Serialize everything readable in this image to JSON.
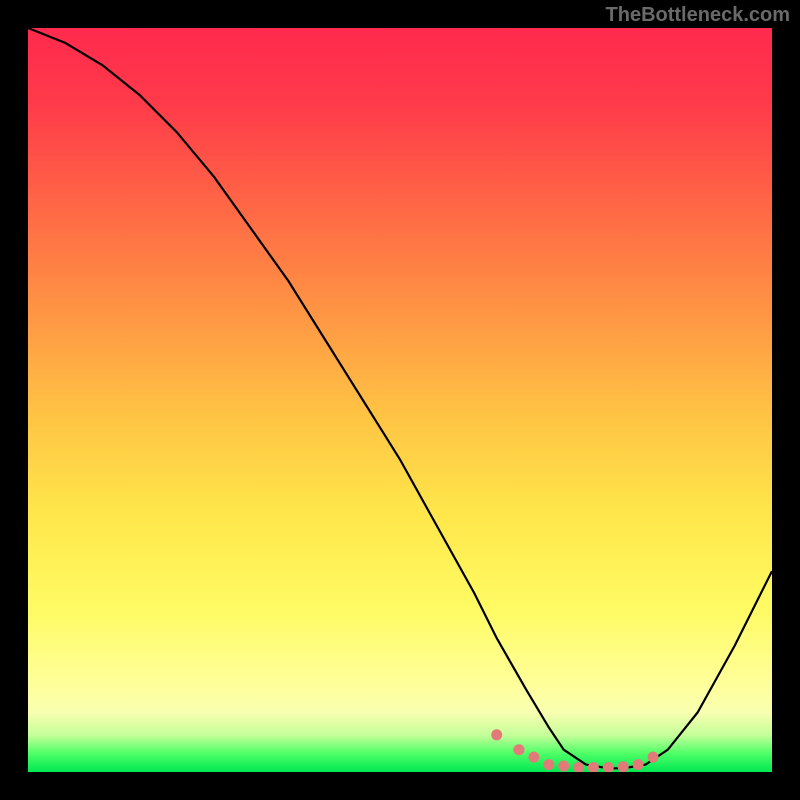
{
  "watermark": "TheBottleneck.com",
  "chart_data": {
    "type": "line",
    "title": "",
    "xlabel": "",
    "ylabel": "",
    "xlim": [
      0,
      100
    ],
    "ylim": [
      0,
      100
    ],
    "series": [
      {
        "name": "bottleneck-curve",
        "x": [
          0,
          5,
          10,
          15,
          20,
          25,
          30,
          35,
          40,
          45,
          50,
          55,
          60,
          63,
          67,
          70,
          72,
          75,
          78,
          80,
          83,
          86,
          90,
          95,
          100
        ],
        "values": [
          100,
          98,
          95,
          91,
          86,
          80,
          73,
          66,
          58,
          50,
          42,
          33,
          24,
          18,
          11,
          6,
          3,
          1,
          0.5,
          0.5,
          1,
          3,
          8,
          17,
          27
        ]
      }
    ],
    "markers": {
      "name": "optimal-range-dots",
      "color": "#e27a7a",
      "x": [
        63,
        66,
        68,
        70,
        72,
        74,
        76,
        78,
        80,
        82,
        84
      ],
      "values": [
        5,
        3,
        2,
        1,
        0.8,
        0.6,
        0.6,
        0.6,
        0.7,
        1,
        2
      ]
    },
    "colors": {
      "background_top": "#ff2a4d",
      "background_mid": "#ffe64a",
      "background_bottom": "#00e852",
      "curve": "#000000",
      "marker": "#e27a7a",
      "frame": "#000000"
    }
  }
}
